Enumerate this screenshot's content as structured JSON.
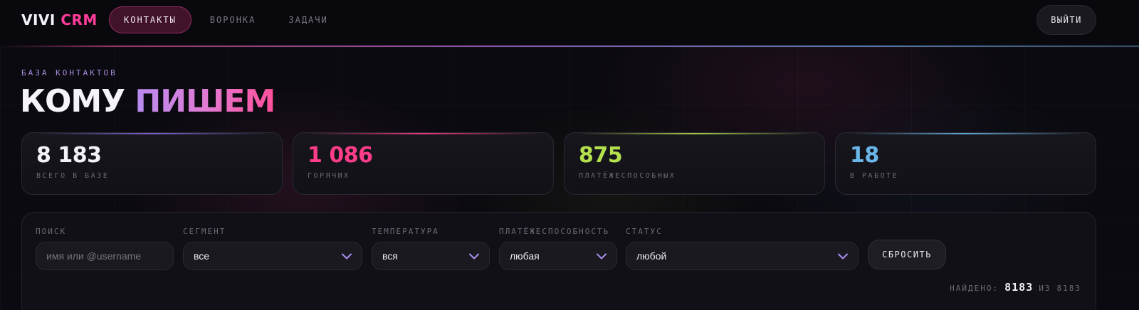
{
  "app": {
    "logo_primary": "VIVI",
    "logo_accent": "CRM"
  },
  "nav": {
    "tabs": [
      {
        "label": "КОНТАКТЫ",
        "active": true
      },
      {
        "label": "ВОРОНКА",
        "active": false
      },
      {
        "label": "ЗАДАЧИ",
        "active": false
      }
    ],
    "logout_label": "ВЫЙТИ"
  },
  "heading": {
    "eyebrow": "БАЗА КОНТАКТОВ",
    "title_part1": "КОМУ",
    "title_part2": "ПИШЕМ"
  },
  "stats": [
    {
      "value": "8 183",
      "label": "ВСЕГО В БАЗЕ",
      "color": "#f4f2f8",
      "accent": "#8a6ae0"
    },
    {
      "value": "1 086",
      "label": "ГОРЯЧИХ",
      "color": "#ff3d8b",
      "accent": "#ff3d8b"
    },
    {
      "value": "875",
      "label": "ПЛАТЁЖЕСПОСОБНЫХ",
      "color": "#b4e04e",
      "accent": "#b4e04e"
    },
    {
      "value": "18",
      "label": "В РАБОТЕ",
      "color": "#6ab6e8",
      "accent": "#6ab6e8"
    }
  ],
  "filters": {
    "search": {
      "label": "ПОИСК",
      "placeholder": "имя или @username",
      "value": ""
    },
    "segment": {
      "label": "СЕГМЕНТ",
      "value": "все"
    },
    "temperature": {
      "label": "ТЕМПЕРАТУРА",
      "value": "вся"
    },
    "solvency": {
      "label": "ПЛАТЁЖЕСПОСОБНОСТЬ",
      "value": "любая"
    },
    "status": {
      "label": "СТАТУС",
      "value": "любой"
    },
    "reset_label": "СБРОСИТЬ",
    "found_prefix": "НАЙДЕНО:",
    "found_count": "8183",
    "found_of": "ИЗ",
    "found_total": "8183"
  },
  "colors": {
    "brand_pink": "#ff3c9a",
    "chevron": "#a98ef0"
  }
}
